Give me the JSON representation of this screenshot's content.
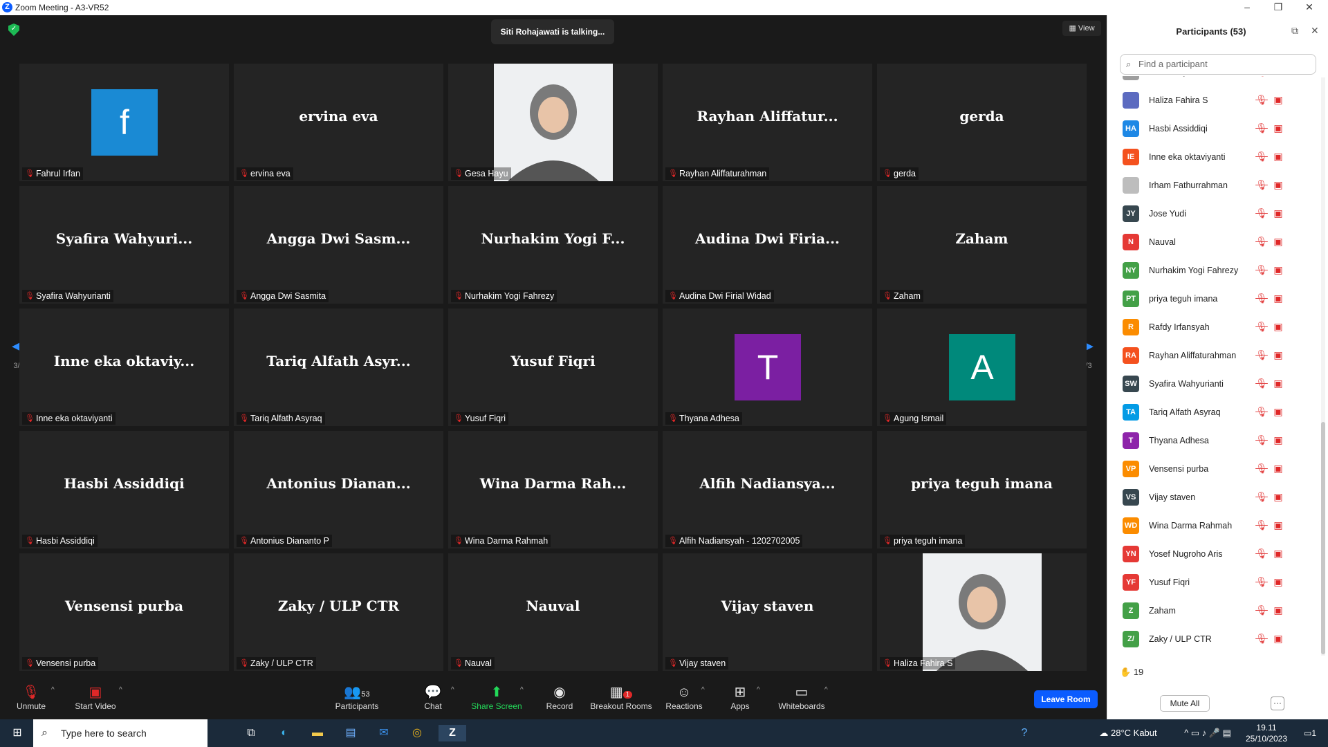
{
  "window": {
    "title": "Zoom Meeting - A3-VR52",
    "logo_letter": "Z",
    "controls": [
      "–",
      "❐",
      "✕"
    ]
  },
  "meeting": {
    "talking": "Siti Rohajawati is talking...",
    "view_label": "View",
    "page_indicator": "3/3",
    "tiles": [
      {
        "label": "Fahrul Irfan",
        "avatar": "f",
        "avatar_color": "#1a8ad4",
        "kind": "avatar"
      },
      {
        "label": "ervina eva",
        "big": "ervina eva",
        "kind": "text"
      },
      {
        "label": "Gesa Hayu",
        "kind": "photo"
      },
      {
        "label": "Rayhan Aliffaturahman",
        "big": "Rayhan  Aliffatur...",
        "kind": "text"
      },
      {
        "label": "gerda",
        "big": "gerda",
        "kind": "text"
      },
      {
        "label": "Syafira Wahyurianti",
        "big": "Syafira  Wahyuri...",
        "kind": "text"
      },
      {
        "label": "Angga Dwi Sasmita",
        "big": "Angga Dwi Sasm...",
        "kind": "text"
      },
      {
        "label": "Nurhakim Yogi Fahrezy",
        "big": "Nurhakim Yogi F...",
        "kind": "text"
      },
      {
        "label": "Audina Dwi Firial Widad",
        "big": "Audina Dwi Firia...",
        "kind": "text"
      },
      {
        "label": "Zaham",
        "big": "Zaham",
        "kind": "text"
      },
      {
        "label": "Inne eka oktaviyanti",
        "big": "Inne eka oktaviy...",
        "kind": "text"
      },
      {
        "label": "Tariq Alfath Asyraq",
        "big": "Tariq Alfath Asyr...",
        "kind": "text"
      },
      {
        "label": "Yusuf Fiqri",
        "big": "Yusuf Fiqri",
        "kind": "text"
      },
      {
        "label": "Thyana Adhesa",
        "avatar": "T",
        "avatar_color": "#7b1fa2",
        "kind": "avatar"
      },
      {
        "label": "Agung Ismail",
        "avatar": "A",
        "avatar_color": "#00897b",
        "kind": "avatar"
      },
      {
        "label": "Hasbi Assiddiqi",
        "big": "Hasbi Assiddiqi",
        "kind": "text"
      },
      {
        "label": "Antonius Diananto P",
        "big": "Antonius  Dianan...",
        "kind": "text"
      },
      {
        "label": "Wina Darma Rahmah",
        "big": "Wina Darma Rah...",
        "kind": "text"
      },
      {
        "label": "Alfih Nadiansyah - 1202702005",
        "big": "Alfih  Nadiansya...",
        "kind": "text"
      },
      {
        "label": "priya teguh imana",
        "big": "priya teguh imana",
        "kind": "text"
      },
      {
        "label": "Vensensi purba",
        "big": "Vensensi purba",
        "kind": "text"
      },
      {
        "label": "Zaky / ULP CTR",
        "big": "Zaky / ULP CTR",
        "kind": "text"
      },
      {
        "label": "Nauval",
        "big": "Nauval",
        "kind": "text"
      },
      {
        "label": "Vijay staven",
        "big": "Vijay staven",
        "kind": "text"
      },
      {
        "label": "Haliza Fahira S",
        "kind": "photo"
      }
    ]
  },
  "toolbar": {
    "unmute": "Unmute",
    "start_video": "Start Video",
    "participants": "Participants",
    "participants_count": "53",
    "chat": "Chat",
    "share": "Share Screen",
    "record": "Record",
    "breakout": "Breakout Rooms",
    "breakout_badge": "1",
    "reactions": "Reactions",
    "apps": "Apps",
    "whiteboards": "Whiteboards",
    "leave": "Leave Room"
  },
  "panel": {
    "title": "Participants (53)",
    "search_placeholder": "Find a participant",
    "hand_count": "19",
    "mute_all": "Mute All",
    "more": "···",
    "participants": [
      {
        "name": "Gesa Hayu",
        "initials": "",
        "color": "#9e9e9e"
      },
      {
        "name": "Haliza Fahira S",
        "initials": "",
        "color": "#5c6bc0"
      },
      {
        "name": "Hasbi Assiddiqi",
        "initials": "HA",
        "color": "#1e88e5"
      },
      {
        "name": "Inne eka oktaviyanti",
        "initials": "IE",
        "color": "#f4511e"
      },
      {
        "name": "Irham Fathurrahman",
        "initials": "",
        "color": "#bdbdbd"
      },
      {
        "name": "Jose Yudi",
        "initials": "JY",
        "color": "#37474f"
      },
      {
        "name": "Nauval",
        "initials": "N",
        "color": "#e53935"
      },
      {
        "name": "Nurhakim Yogi Fahrezy",
        "initials": "NY",
        "color": "#43a047"
      },
      {
        "name": "priya teguh imana",
        "initials": "PT",
        "color": "#43a047"
      },
      {
        "name": "Rafdy Irfansyah",
        "initials": "R",
        "color": "#fb8c00"
      },
      {
        "name": "Rayhan Aliffaturahman",
        "initials": "RA",
        "color": "#f4511e"
      },
      {
        "name": "Syafira Wahyurianti",
        "initials": "SW",
        "color": "#37474f"
      },
      {
        "name": "Tariq Alfath Asyraq",
        "initials": "TA",
        "color": "#039be5"
      },
      {
        "name": "Thyana Adhesa",
        "initials": "T",
        "color": "#8e24aa"
      },
      {
        "name": "Vensensi purba",
        "initials": "VP",
        "color": "#fb8c00"
      },
      {
        "name": "Vijay staven",
        "initials": "VS",
        "color": "#37474f"
      },
      {
        "name": "Wina Darma Rahmah",
        "initials": "WD",
        "color": "#fb8c00"
      },
      {
        "name": "Yosef Nugroho Aris",
        "initials": "YN",
        "color": "#e53935"
      },
      {
        "name": "Yusuf Fiqri",
        "initials": "YF",
        "color": "#e53935"
      },
      {
        "name": "Zaham",
        "initials": "Z",
        "color": "#43a047"
      },
      {
        "name": "Zaky / ULP CTR",
        "initials": "Z/",
        "color": "#43a047"
      }
    ]
  },
  "taskbar": {
    "search_placeholder": "Type here to search",
    "weather": "28°C  Kabut",
    "time": "19.11",
    "date": "25/10/2023",
    "notif": "1"
  }
}
